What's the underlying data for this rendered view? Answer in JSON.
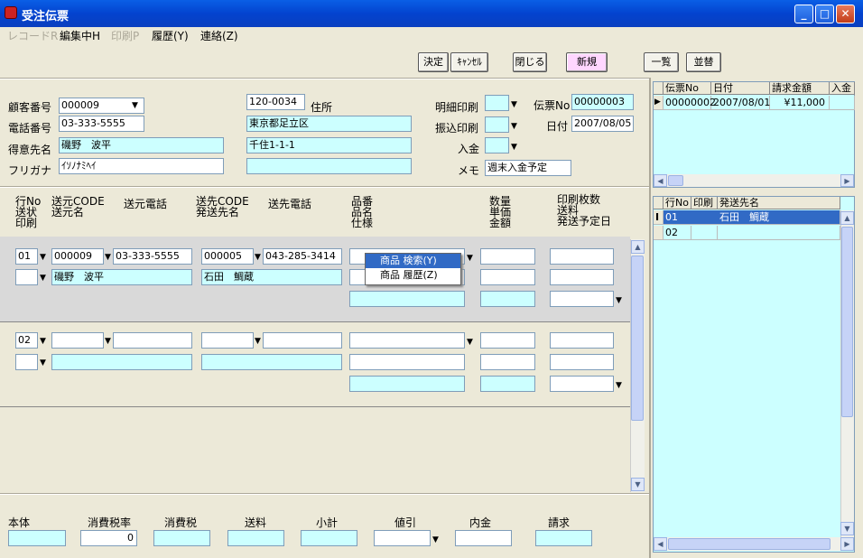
{
  "window": {
    "title": "受注伝票"
  },
  "menu": [
    "レコードR",
    "編集中H",
    "印刷P",
    "履歴(Y)",
    "連絡(Z)"
  ],
  "toolbar": {
    "decide": "決定",
    "cancel": "ｷｬﾝｾﾙ",
    "close": "閉じる",
    "new": "新規",
    "list": "一覧",
    "sort": "並替"
  },
  "header": {
    "customer_no_label": "顧客番号",
    "customer_no": "000009",
    "phone_label": "電話番号",
    "phone": "03-333-5555",
    "customer_name_label": "得意先名",
    "customer_name": "磯野　波平",
    "furigana_label": "フリガナ",
    "furigana": "ｲｿﾉﾅﾐﾍｲ",
    "postal": "120-0034",
    "address_label": "住所",
    "address1": "東京都足立区",
    "address2": "千住1-1-1",
    "address3": "",
    "detail_print_label": "明細印刷",
    "transfer_print_label": "振込印刷",
    "deposit_label": "入金",
    "memo_label": "メモ",
    "memo": "週末入金予定",
    "slip_no_label": "伝票No",
    "slip_no": "00000003",
    "date_label": "日付",
    "date": "2007/08/05"
  },
  "columns": {
    "c1": [
      "行No",
      "送状",
      "印刷"
    ],
    "c2": [
      "送元CODE",
      "送元名"
    ],
    "c3": "送元電話",
    "c4": [
      "送先CODE",
      "発送先名"
    ],
    "c5": "送先電話",
    "c6": [
      "品番",
      "品名",
      "仕様"
    ],
    "c7": [
      "数量",
      "単価",
      "金額"
    ],
    "c8": [
      "印刷枚数",
      "送料",
      "発送予定日"
    ]
  },
  "rows": [
    {
      "no": "01",
      "src_code": "000009",
      "src_phone": "03-333-5555",
      "dst_code": "000005",
      "dst_phone": "043-285-3414",
      "src_name": "磯野　波平",
      "dst_name": "石田　鯛蔵"
    },
    {
      "no": "02",
      "src_code": "",
      "src_phone": "",
      "dst_code": "",
      "dst_phone": "",
      "src_name": "",
      "dst_name": ""
    }
  ],
  "popup": [
    "商品 検索(Y)",
    "商品 履歴(Z)"
  ],
  "footer": {
    "body_label": "本体",
    "tax_rate_label": "消費税率",
    "tax_rate": "0",
    "tax_label": "消費税",
    "shipping_label": "送料",
    "subtotal_label": "小計",
    "discount_label": "値引",
    "deposit_label": "内金",
    "invoice_label": "請求"
  },
  "right_top": {
    "headers": [
      "伝票No",
      "日付",
      "請求金額",
      "入金"
    ],
    "rows": [
      [
        "00000002",
        "2007/08/01",
        "¥11,000",
        ""
      ]
    ]
  },
  "right_bottom": {
    "headers": [
      "行No",
      "印刷",
      "発送先名"
    ],
    "rows": [
      [
        "01",
        "",
        "石田　鯛蔵"
      ],
      [
        "02",
        "",
        ""
      ]
    ]
  }
}
